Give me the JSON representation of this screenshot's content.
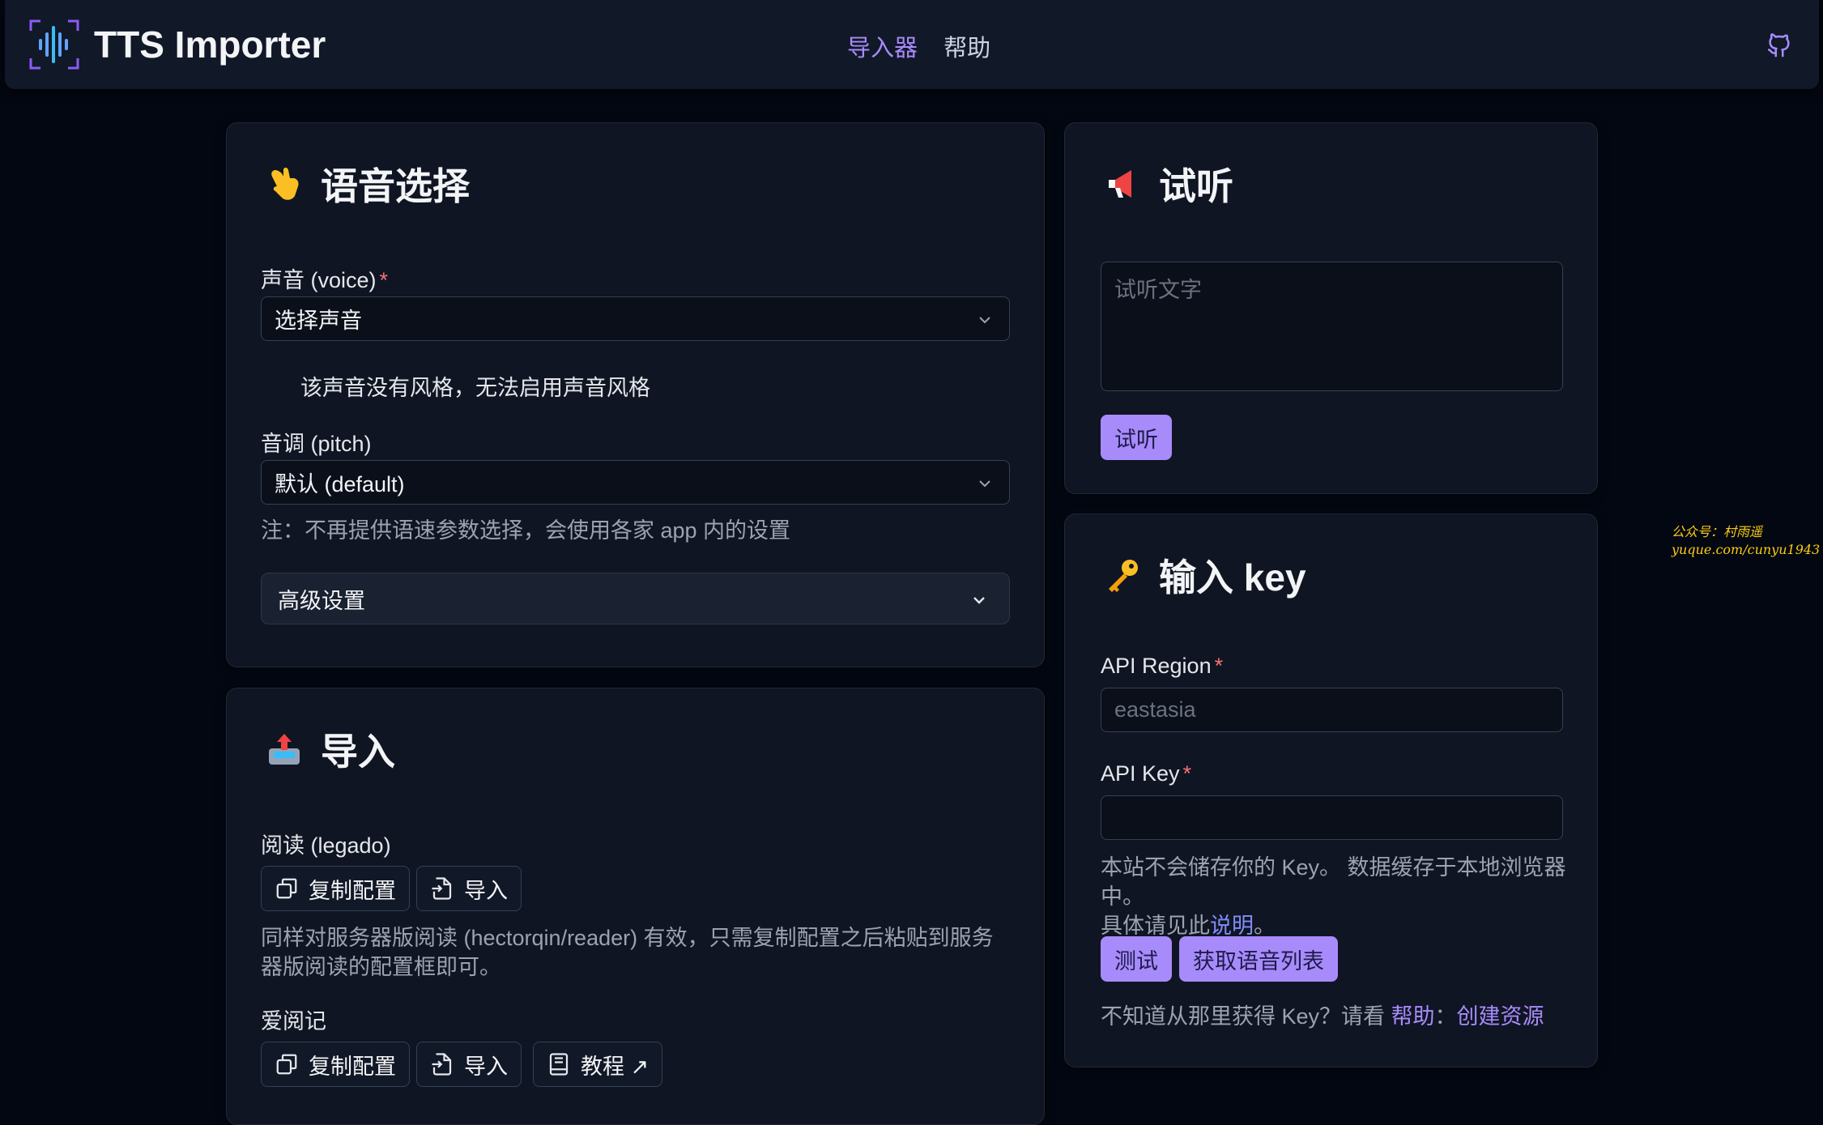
{
  "header": {
    "app_title": "TTS Importer",
    "nav": [
      {
        "label": "导入器",
        "active": true
      },
      {
        "label": "帮助",
        "active": false
      }
    ],
    "accent_color": "#a78bfa"
  },
  "voice_card": {
    "title": "语音选择",
    "emoji": "backhand-index-pointing-down",
    "voice_label": "声音 (voice)",
    "voice_required": "*",
    "voice_value": "选择声音",
    "style_note": "该声音没有风格，无法启用声音风格",
    "pitch_label": "音调 (pitch)",
    "pitch_value": "默认 (default)",
    "speed_note": "注：不再提供语速参数选择，会使用各家 app 内的设置",
    "advanced_label": "高级设置"
  },
  "import_card": {
    "title": "导入",
    "emoji": "outbox-tray",
    "legado_label": "阅读 (legado)",
    "copy_config": "复制配置",
    "import": "导入",
    "legado_note": "同样对服务器版阅读 (hectorqin/reader) 有效，只需复制配置之后粘贴到服务器版阅读的配置框即可。",
    "aiyueji_label": "爱阅记",
    "tutorial": "教程 ↗"
  },
  "preview_card": {
    "title": "试听",
    "emoji": "loudspeaker",
    "textarea_placeholder": "试听文字",
    "button": "试听"
  },
  "key_card": {
    "title": "输入 key",
    "emoji": "key",
    "region_label": "API Region",
    "region_placeholder": "eastasia",
    "key_label": "API Key",
    "required": "*",
    "privacy_note_1": "本站不会储存你的 Key。 数据缓存于本地浏览器中。",
    "privacy_note_2_prefix": "具体请见此",
    "privacy_note_2_link": "说明",
    "privacy_note_2_suffix": "。",
    "test_button": "测试",
    "list_button": "获取语音列表",
    "help_prefix": "不知道从那里获得 Key？请看 ",
    "help_link": "帮助",
    "help_sep": "：",
    "create_link": "创建资源"
  },
  "watermark": {
    "line1": "公众号：村雨遥",
    "line2": "yuque.com/cunyu1943"
  }
}
